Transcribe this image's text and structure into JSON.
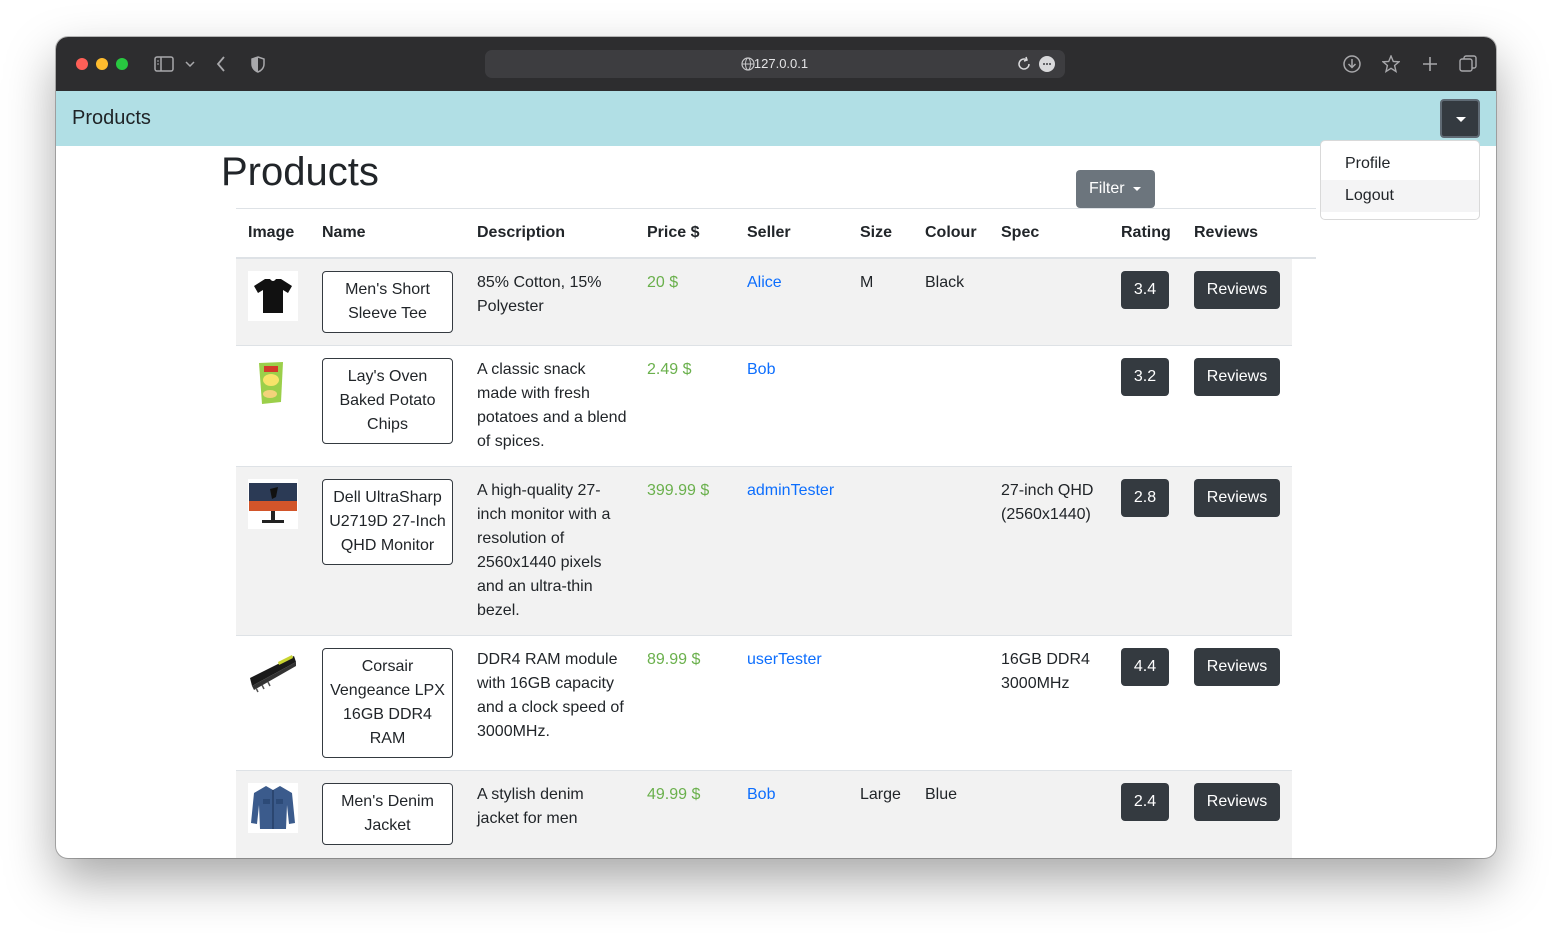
{
  "browser": {
    "url": "127.0.0.1"
  },
  "navbar": {
    "brand": "Products",
    "dropdown_items": [
      "Profile",
      "Logout"
    ]
  },
  "page": {
    "title": "Products",
    "filter_label": "Filter"
  },
  "table": {
    "headers": [
      "Image",
      "Name",
      "Description",
      "Price $",
      "Seller",
      "Size",
      "Colour",
      "Spec",
      "Rating",
      "Reviews"
    ],
    "rows": [
      {
        "image": "t-shirt-image",
        "name": "Men's Short Sleeve Tee",
        "description": "85% Cotton, 15% Polyester",
        "price": "20 $",
        "seller": "Alice",
        "size": "M",
        "colour": "Black",
        "spec": "",
        "rating": "3.4",
        "reviews_label": "Reviews"
      },
      {
        "image": "chips-bag-image",
        "name": "Lay's Oven Baked Potato Chips",
        "description": "A classic snack made with fresh potatoes and a blend of spices.",
        "price": "2.49 $",
        "seller": "Bob",
        "size": "",
        "colour": "",
        "spec": "",
        "rating": "3.2",
        "reviews_label": "Reviews"
      },
      {
        "image": "monitor-image",
        "name": "Dell UltraSharp U2719D 27-Inch QHD Monitor",
        "description": "A high-quality 27-inch monitor with a resolution of 2560x1440 pixels and an ultra-thin bezel.",
        "price": "399.99 $",
        "seller": "adminTester",
        "size": "",
        "colour": "",
        "spec": "27-inch QHD (2560x1440)",
        "rating": "2.8",
        "reviews_label": "Reviews"
      },
      {
        "image": "ram-module-image",
        "name": "Corsair Vengeance LPX 16GB DDR4 RAM",
        "description": "DDR4 RAM module with 16GB capacity and a clock speed of 3000MHz.",
        "price": "89.99 $",
        "seller": "userTester",
        "size": "",
        "colour": "",
        "spec": "16GB DDR4 3000MHz",
        "rating": "4.4",
        "reviews_label": "Reviews"
      },
      {
        "image": "denim-jacket-image",
        "name": "Men's Denim Jacket",
        "description": "A stylish denim jacket for men",
        "price": "49.99 $",
        "seller": "Bob",
        "size": "Large",
        "colour": "Blue",
        "spec": "",
        "rating": "2.4",
        "reviews_label": "Reviews"
      }
    ]
  }
}
